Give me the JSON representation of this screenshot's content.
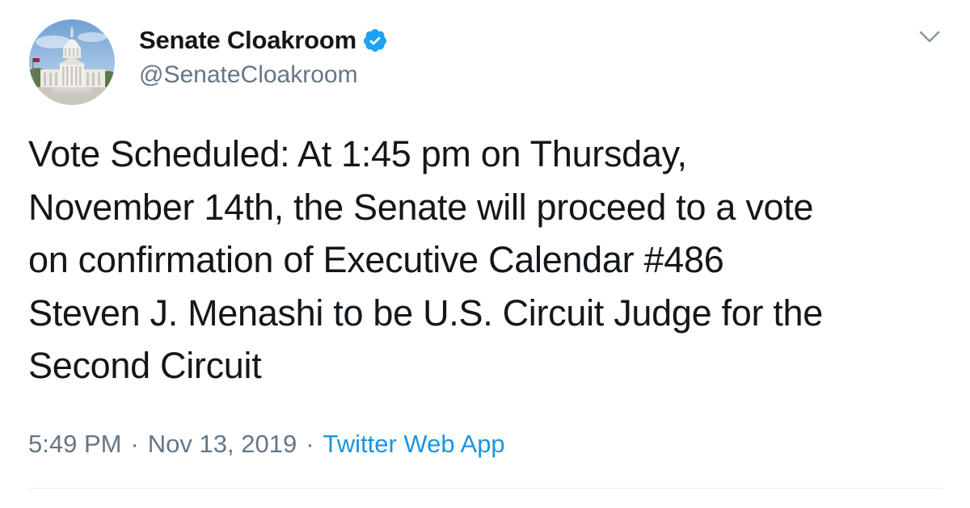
{
  "author": {
    "display_name": "Senate Cloakroom",
    "handle": "@SenateCloakroom",
    "verified": true,
    "avatar_icon": "capitol-building-avatar"
  },
  "tweet": {
    "text_lines": [
      "Vote Scheduled: At 1:45 pm on Thursday,",
      "November 14th, the Senate will proceed to a vote",
      "on confirmation of Executive Calendar #486",
      "Steven J. Menashi to be U.S. Circuit Judge for the",
      "Second Circuit"
    ],
    "time": "5:49 PM",
    "separator": "·",
    "date": "Nov 13, 2019",
    "source": "Twitter Web App"
  },
  "colors": {
    "text": "#14171a",
    "secondary": "#657786",
    "link": "#1b95e0",
    "verified_badge": "#1da1f2",
    "divider": "#e6ecf0"
  },
  "icons": {
    "verified": "verified-badge-icon",
    "more": "chevron-down-icon"
  }
}
